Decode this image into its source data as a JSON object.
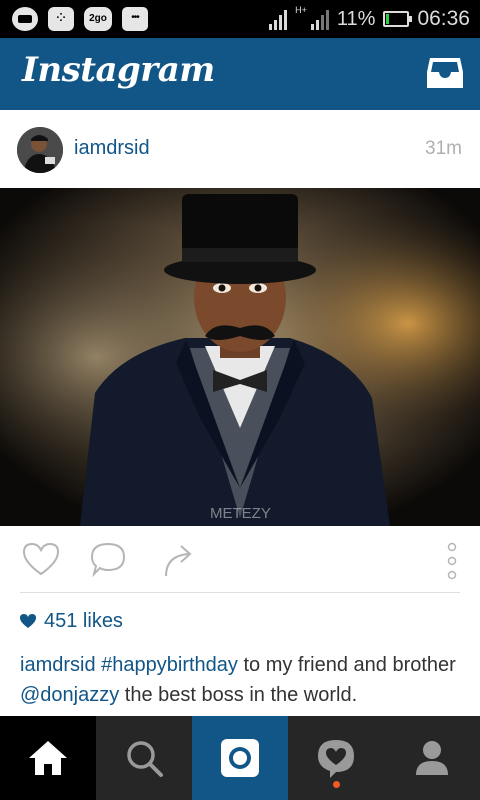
{
  "status_bar": {
    "network_label": "H+",
    "battery_percent": "11%",
    "battery_level": 0.11,
    "time": "06:36",
    "icons": [
      "messenger-icon",
      "bbm-icon",
      "2go-icon",
      "chat-icon",
      "signal-icon",
      "battery-icon"
    ],
    "app_label_2go": "2go"
  },
  "app": {
    "title": "Instagram",
    "brand_color": "#125688"
  },
  "post": {
    "username": "iamdrsid",
    "time_ago": "31m",
    "watermark": "METEZY",
    "likes": "451 likes",
    "caption": {
      "username": "iamdrsid",
      "hashtag": "#happybirthday",
      "text1": " to my friend and brother ",
      "mention": "@donjazzy",
      "text2": " the best boss in the world."
    }
  },
  "bottom_nav": {
    "tabs": [
      "home",
      "search",
      "camera",
      "activity",
      "profile"
    ],
    "active": "home"
  }
}
